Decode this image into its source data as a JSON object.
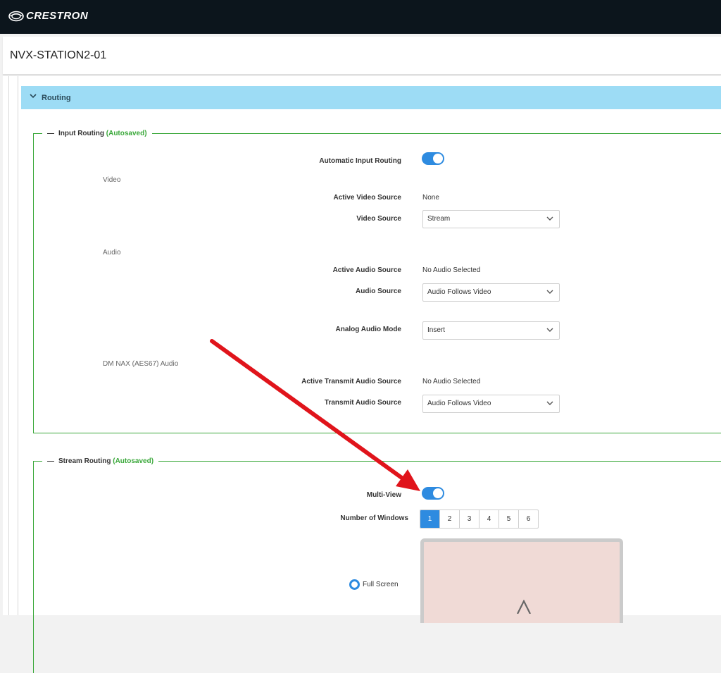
{
  "header": {
    "logo_text": "CRESTRON"
  },
  "page": {
    "title": "NVX-STATION2-01"
  },
  "routing": {
    "section_label": "Routing",
    "input_routing": {
      "legend_title": "Input Routing",
      "legend_status": "(Autosaved)",
      "automatic_input_routing": {
        "label": "Automatic Input Routing",
        "enabled": true
      },
      "video": {
        "heading": "Video",
        "active_source_label": "Active Video Source",
        "active_source_value": "None",
        "source_label": "Video Source",
        "source_value": "Stream"
      },
      "audio": {
        "heading": "Audio",
        "active_source_label": "Active Audio Source",
        "active_source_value": "No Audio Selected",
        "source_label": "Audio Source",
        "source_value": "Audio Follows Video",
        "analog_mode_label": "Analog Audio Mode",
        "analog_mode_value": "Insert"
      },
      "dm_nax": {
        "heading": "DM NAX (AES67) Audio",
        "active_transmit_label": "Active Transmit Audio Source",
        "active_transmit_value": "No Audio Selected",
        "transmit_label": "Transmit Audio Source",
        "transmit_value": "Audio Follows Video"
      }
    },
    "stream_routing": {
      "legend_title": "Stream Routing",
      "legend_status": "(Autosaved)",
      "multi_view": {
        "label": "Multi-View",
        "enabled": true
      },
      "number_of_windows": {
        "label": "Number of Windows",
        "options": [
          "1",
          "2",
          "3",
          "4",
          "5",
          "6"
        ],
        "selected": "1"
      },
      "layout_option": {
        "label": "Full Screen",
        "selected": true
      },
      "preview_glyph": "A"
    }
  },
  "colors": {
    "topbar": "#0c151c",
    "routing_header": "#9ddcf5",
    "group_border": "#3aa83a",
    "autosaved_text": "#3aa83a",
    "toggle_on": "#2e8be0",
    "segment_active": "#2e8be0",
    "preview_bg": "#f0dad6",
    "annotation_arrow": "#e0141b"
  },
  "icons": {
    "logo": "crestron-logo-icon",
    "collapse": "chevron-down-icon",
    "select": "chevron-down-icon",
    "annotation": "red-arrow-icon"
  }
}
